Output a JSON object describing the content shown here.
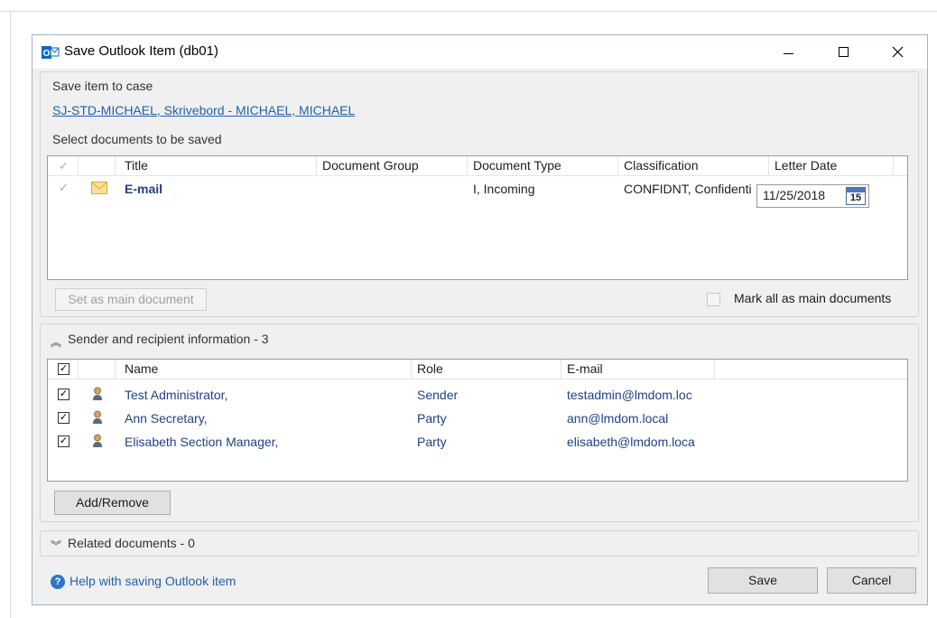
{
  "window": {
    "title": "Save Outlook Item (db01)",
    "app_icon_letter": "O"
  },
  "case": {
    "label": "Save item to case",
    "link": "SJ-STD-MICHAEL, Skrivebord - MICHAEL, MICHAEL"
  },
  "documents": {
    "label": "Select documents to be saved",
    "columns": [
      "Title",
      "Document Group",
      "Document Type",
      "Classification",
      "Letter Date"
    ],
    "rows": [
      {
        "title": "E-mail",
        "group": "",
        "type": "I, Incoming",
        "classification": "CONFIDNT, Confidenti",
        "letter_date": "11/25/2018",
        "calendar_day": "15"
      }
    ],
    "set_main_label": "Set as main document",
    "mark_all_label": "Mark all as main documents"
  },
  "senders": {
    "header": "Sender and recipient information - 3",
    "columns": [
      "Name",
      "Role",
      "E-mail"
    ],
    "rows": [
      {
        "name": "Test Administrator,",
        "role": "Sender",
        "email": "testadmin@lmdom.loc"
      },
      {
        "name": "Ann Secretary,",
        "role": "Party",
        "email": "ann@lmdom.local"
      },
      {
        "name": "Elisabeth Section Manager,",
        "role": "Party",
        "email": "elisabeth@lmdom.loca"
      }
    ],
    "add_remove_label": "Add/Remove"
  },
  "related": {
    "header": "Related documents - 0"
  },
  "footer": {
    "help_label": "Help with saving Outlook item",
    "save_label": "Save",
    "cancel_label": "Cancel"
  },
  "colors": {
    "link": "#2060b0",
    "row_text": "#1f3f8a",
    "outlook_blue": "#0a6ac4"
  }
}
